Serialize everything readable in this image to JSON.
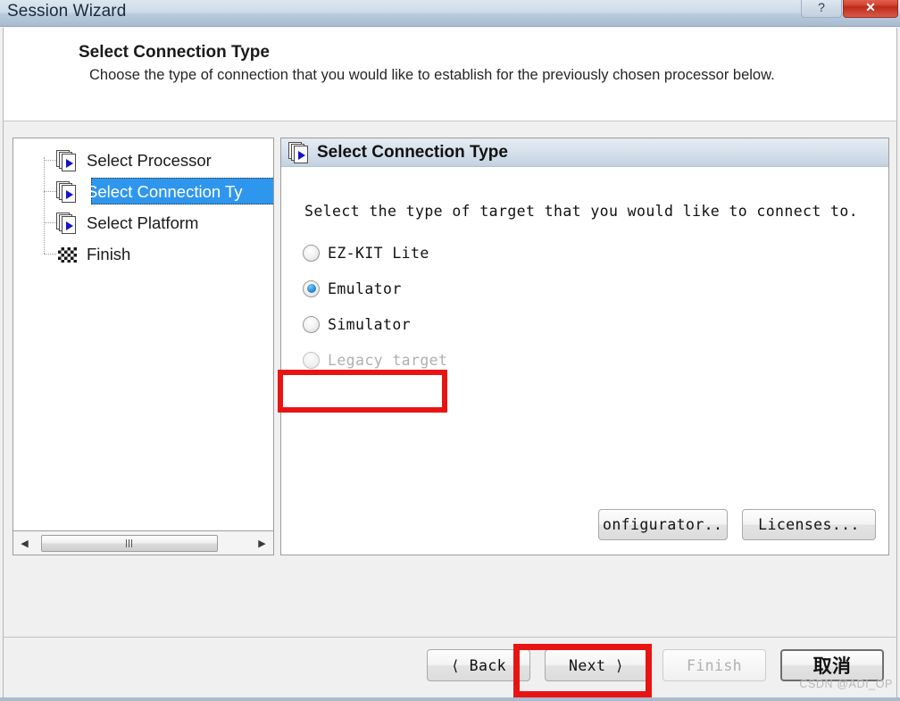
{
  "window": {
    "title": "Session Wizard",
    "caption_buttons": [
      {
        "name": "help-button",
        "glyph": "?"
      },
      {
        "name": "close-button",
        "glyph": "✕"
      }
    ]
  },
  "header": {
    "title": "Select Connection Type",
    "subtitle": "Choose the type of connection that you would like to establish for the previously chosen processor below."
  },
  "tree": {
    "items": [
      {
        "label": "Select Processor",
        "icon": "wizard-page-icon",
        "selected": false
      },
      {
        "label": "Select Connection Ty",
        "icon": "wizard-page-icon",
        "selected": true
      },
      {
        "label": "Select Platform",
        "icon": "wizard-page-icon",
        "selected": false
      },
      {
        "label": "Finish",
        "icon": "checkered-flag-icon",
        "selected": false
      }
    ],
    "scrollbar": {
      "left_arrow": "◀",
      "right_arrow": "▶"
    }
  },
  "content": {
    "panel_title": "Select Connection Type",
    "intro": "Select the type of target that you would like to connect to.",
    "options": [
      {
        "label": "EZ-KIT Lite",
        "checked": false,
        "disabled": false
      },
      {
        "label": "Emulator",
        "checked": true,
        "disabled": false
      },
      {
        "label": "Simulator",
        "checked": false,
        "disabled": false
      },
      {
        "label": "Legacy target",
        "checked": false,
        "disabled": true
      }
    ],
    "buttons": [
      {
        "name": "configurator-button",
        "label": "onfigurator..",
        "disabled": false
      },
      {
        "name": "licenses-button",
        "label": "Licenses...",
        "disabled": false
      }
    ]
  },
  "footer": {
    "buttons": [
      {
        "name": "back-button",
        "label": "⟨ Back",
        "disabled": false
      },
      {
        "name": "next-button",
        "label": "Next ⟩",
        "disabled": false
      },
      {
        "name": "finish-button",
        "label": "Finish",
        "disabled": true
      },
      {
        "name": "cancel-button",
        "label": "取消",
        "disabled": false
      }
    ]
  },
  "annotations": {
    "highlight_color": "#e81414",
    "emulator_highlight": "Emulator",
    "next_highlight": "Next"
  },
  "watermark": "CSDN @ADI_OP"
}
